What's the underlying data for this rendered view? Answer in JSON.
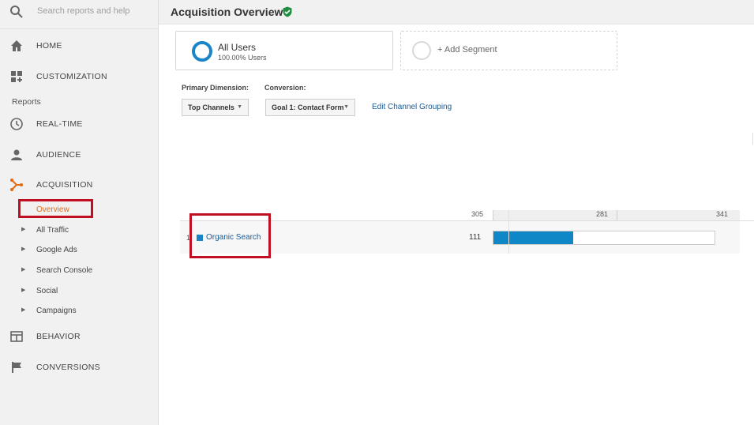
{
  "search": {
    "placeholder": "Search reports and help"
  },
  "nav": {
    "home": "HOME",
    "customization": "CUSTOMIZATION",
    "reports_label": "Reports",
    "realtime": "REAL-TIME",
    "audience": "AUDIENCE",
    "acquisition": "ACQUISITION",
    "acquisition_sub": [
      "Overview",
      "All Traffic",
      "Google Ads",
      "Search Console",
      "Social",
      "Campaigns"
    ],
    "behavior": "BEHAVIOR",
    "conversions": "CONVERSIONS"
  },
  "header": {
    "title": "Acquisition Overview"
  },
  "segments": {
    "active_name": "All Users",
    "active_pct": "100.00% Users",
    "add_label": "+ Add Segment"
  },
  "controls": {
    "primary_dimension_label": "Primary Dimension:",
    "primary_dimension_value": "Top Channels",
    "conversion_label": "Conversion:",
    "conversion_value": "Goal 1: Contact Form",
    "edit_link": "Edit Channel Grouping"
  },
  "table": {
    "axis_ticks": [
      "305",
      "281",
      "341"
    ],
    "rows": [
      {
        "index": "1",
        "channel": "Organic Search",
        "value": "111",
        "bar_fraction": 0.36
      }
    ]
  },
  "colors": {
    "accent": "#1a85c9",
    "highlight_orange": "#e36b12",
    "annotation_red": "#c00f23",
    "verified_green": "#1e8e3e"
  }
}
